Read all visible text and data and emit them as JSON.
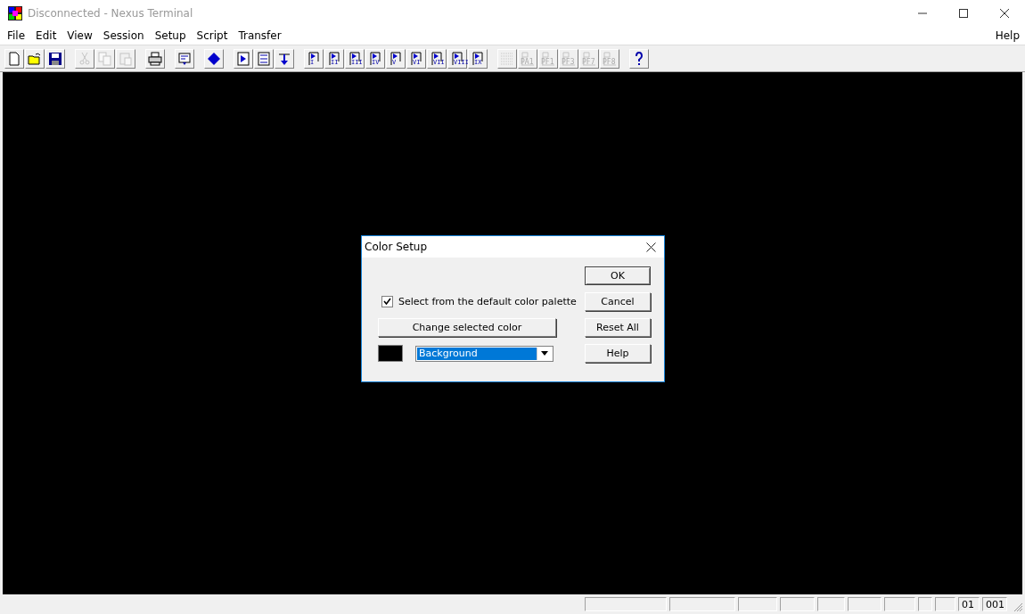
{
  "window": {
    "title": "Disconnected - Nexus Terminal"
  },
  "menu": {
    "items": [
      {
        "label": "File"
      },
      {
        "label": "Edit"
      },
      {
        "label": "View"
      },
      {
        "label": "Session"
      },
      {
        "label": "Setup"
      },
      {
        "label": "Script"
      },
      {
        "label": "Transfer"
      }
    ],
    "right_item": {
      "label": "Help"
    }
  },
  "toolbar": {
    "groups": [
      [
        {
          "kind": "new",
          "disabled": false
        },
        {
          "kind": "open",
          "disabled": false
        },
        {
          "kind": "save",
          "disabled": false
        }
      ],
      [
        {
          "kind": "cut",
          "disabled": true
        },
        {
          "kind": "copy",
          "disabled": true
        },
        {
          "kind": "paste",
          "disabled": true
        }
      ],
      [
        {
          "kind": "print",
          "disabled": false
        }
      ],
      [
        {
          "kind": "capture",
          "disabled": false
        }
      ],
      [
        {
          "kind": "diamond",
          "disabled": false
        }
      ],
      [
        {
          "kind": "play",
          "disabled": false
        },
        {
          "kind": "list",
          "disabled": false
        },
        {
          "kind": "step",
          "disabled": false
        }
      ],
      [
        {
          "kind": "macro",
          "label": "I",
          "disabled": false
        },
        {
          "kind": "macro",
          "label": "II",
          "disabled": false
        },
        {
          "kind": "macro",
          "label": "III",
          "disabled": false
        },
        {
          "kind": "macro",
          "label": "IV",
          "disabled": false
        },
        {
          "kind": "macro",
          "label": "V",
          "disabled": false
        },
        {
          "kind": "macro",
          "label": "VI",
          "disabled": false
        },
        {
          "kind": "macro",
          "label": "VII",
          "disabled": false
        },
        {
          "kind": "macro",
          "label": "VIII",
          "disabled": false
        },
        {
          "kind": "macro",
          "label": "IX",
          "disabled": false
        }
      ],
      [
        {
          "kind": "grid",
          "disabled": true
        },
        {
          "kind": "key",
          "label": "PA1",
          "disabled": true
        },
        {
          "kind": "key",
          "label": "PF1",
          "disabled": true
        },
        {
          "kind": "key",
          "label": "PF3",
          "disabled": true
        },
        {
          "kind": "key",
          "label": "PF7",
          "disabled": true
        },
        {
          "kind": "key",
          "label": "PF8",
          "disabled": true
        }
      ],
      [
        {
          "kind": "help",
          "disabled": false
        }
      ]
    ]
  },
  "dialog": {
    "title": "Color Setup",
    "checkbox": {
      "label": "Select from the default color palette",
      "checked": true
    },
    "change_button": {
      "label": "Change selected color"
    },
    "swatch": {
      "color": "#000000"
    },
    "dropdown": {
      "value": "Background"
    },
    "buttons": [
      {
        "label": "OK",
        "default": true
      },
      {
        "label": "Cancel",
        "default": false
      },
      {
        "label": "Reset All",
        "default": false
      },
      {
        "label": "Help",
        "default": false
      }
    ]
  },
  "status_bar": {
    "panes": [
      {
        "kind": "blank"
      },
      {
        "kind": "blank"
      },
      {
        "kind": "blank"
      },
      {
        "kind": "blank"
      },
      {
        "kind": "blank"
      },
      {
        "kind": "blank"
      },
      {
        "kind": "blank"
      },
      {
        "kind": "blank"
      },
      {
        "kind": "blank"
      },
      {
        "kind": "text",
        "text": "01"
      },
      {
        "kind": "text",
        "text": "001"
      }
    ]
  }
}
